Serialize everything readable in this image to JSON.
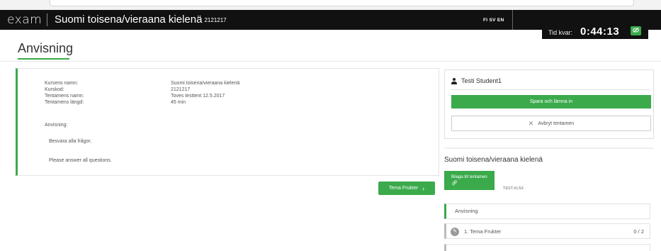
{
  "header": {
    "logo": "exam",
    "course_title": "Suomi toisena/vieraana kielenä",
    "course_code": "2121217",
    "languages": "FI SV EN"
  },
  "timer": {
    "label": "Tid kvar:",
    "value": "0:44:13",
    "icon": "eye-slash-icon"
  },
  "page": {
    "title": "Anvisning"
  },
  "info": {
    "rows": [
      {
        "label": "Kursens namn:",
        "value": "Suomi toisena/vieraana kielenä"
      },
      {
        "label": "Kurskod:",
        "value": "2121217"
      },
      {
        "label": "Tentamens namn:",
        "value": "Toves testtent 12.5.2017"
      },
      {
        "label": "Tentamens längd:",
        "value": "45 min"
      }
    ],
    "instructions_label": "Anvisning:",
    "instructions_sv": "Besvara alla frågor.",
    "instructions_en": "Please answer all questions."
  },
  "navigation": {
    "next_label": "Tema Frukter"
  },
  "sidebar": {
    "user_name": "Testi Student1",
    "submit_label": "Spara och lämna in",
    "cancel_label": "Avbryt tentamen",
    "course_name": "Suomi toisena/vieraana kielenä",
    "attachment_label": "Bilaga till tentamen",
    "attachment_file": "TEST.XLSX",
    "sections": [
      {
        "label": "Anvisning"
      },
      {
        "label": "1. Tema Frukter",
        "score": "0 / 2"
      }
    ]
  },
  "colors": {
    "accent": "#3aaa4b",
    "header": "#111111"
  }
}
